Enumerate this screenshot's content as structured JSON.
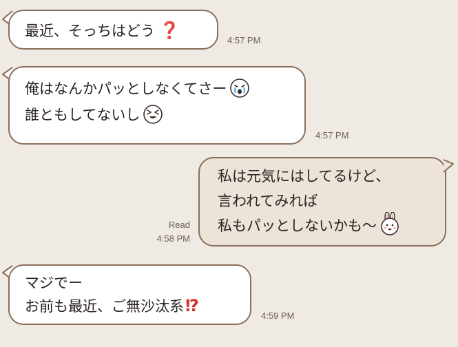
{
  "colors": {
    "background": "#efeae4",
    "incoming_bubble": "#ffffff",
    "outgoing_bubble": "#ece3d9",
    "border": "#8a6e5a",
    "accent_red": "#d8312b"
  },
  "messages": [
    {
      "direction": "incoming",
      "lines": [
        "最近、そっちはどう"
      ],
      "trailing": [
        "❓"
      ],
      "time": "4:57 PM"
    },
    {
      "direction": "incoming",
      "lines": [
        "俺はなんかパッとしなくてさー",
        "誰ともしてないし"
      ],
      "trailing": [
        "crying-face-emoji",
        "laughing-face-emoji"
      ],
      "time": "4:57 PM"
    },
    {
      "direction": "outgoing",
      "lines": [
        "私は元気にはしてるけど、",
        "言われてみれば",
        "私もパッとしないかも〜"
      ],
      "trailing": [
        "bunny-face-emoji"
      ],
      "read": "Read",
      "time": "4:58 PM"
    },
    {
      "direction": "incoming",
      "lines": [
        "マジでー",
        "お前も最近、ご無沙汰系"
      ],
      "trailing": [
        "⁉"
      ],
      "time": "4:59 PM"
    }
  ]
}
